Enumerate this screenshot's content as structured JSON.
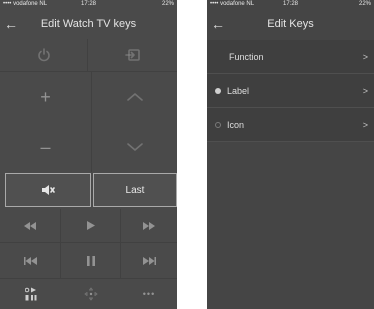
{
  "left_screen": {
    "status": {
      "carrier": "•••• vodafone NL",
      "time": "17:28",
      "battery": "22%"
    },
    "title": "Edit Watch TV keys",
    "keys": {
      "power": "power-icon",
      "input": "input-source-icon",
      "volume_up": "+",
      "volume_down": "–",
      "channel_up": "chevron-up-icon",
      "channel_down": "chevron-down-icon",
      "mute": "speaker-mute-icon",
      "last": "Last",
      "rewind": "rewind-icon",
      "play": "play-icon",
      "fast_forward": "fast-forward-icon",
      "skip_back": "skip-back-icon",
      "pause": "pause-icon",
      "skip_forward": "skip-forward-icon",
      "playpause_grid": "play-pause-grid-icon",
      "dpad": "dpad-icon",
      "more": "•••"
    }
  },
  "right_screen": {
    "status": {
      "carrier": "•••• vodafone NL",
      "time": "17:28",
      "battery": "22%"
    },
    "title": "Edit Keys",
    "rows": [
      {
        "label": "Function",
        "radio": "none"
      },
      {
        "label": "Label",
        "radio": "on"
      },
      {
        "label": "Icon",
        "radio": "off"
      }
    ],
    "chevron": ">"
  }
}
